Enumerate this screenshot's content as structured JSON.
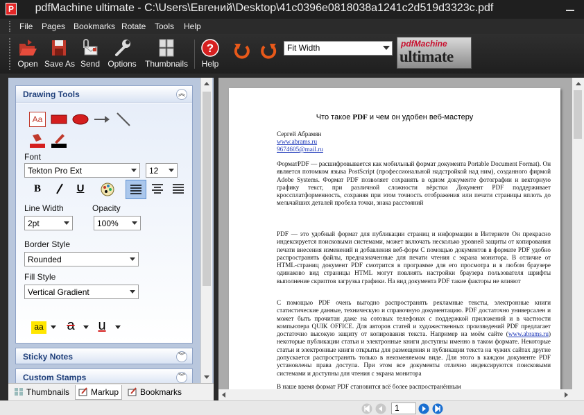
{
  "window": {
    "title": "pdfMachine ultimate - C:\\Users\\Евгений\\Desktop\\41c0396e0818038a1241c2d519d3323c.pdf",
    "app_icon_letter": "P"
  },
  "menu": {
    "items": [
      "File",
      "Pages",
      "Bookmarks",
      "Rotate",
      "Tools",
      "Help"
    ]
  },
  "toolbar": {
    "open": "Open",
    "save_as": "Save As",
    "send": "Send",
    "options": "Options",
    "thumbnails": "Thumbnails",
    "help": "Help",
    "zoom_value": "Fit Width",
    "logo_top": "pdfMachine",
    "logo_bottom": "ultimate"
  },
  "drawing_tools": {
    "title": "Drawing Tools",
    "tool_text_label": "Aa",
    "font_label": "Font",
    "font_value": "Tekton Pro Ext",
    "font_size": "12",
    "bold": "B",
    "italic": "I",
    "underline": "U",
    "line_width_label": "Line Width",
    "line_width_value": "2pt",
    "opacity_label": "Opacity",
    "opacity_value": "100%",
    "border_style_label": "Border Style",
    "border_style_value": "Rounded",
    "fill_style_label": "Fill Style",
    "fill_style_value": "Vertical Gradient",
    "highlight_sample": "aa",
    "strike_sample": "a",
    "underline_sample": "u"
  },
  "panels": {
    "sticky_notes": "Sticky Notes",
    "custom_stamps": "Custom Stamps"
  },
  "tabs": {
    "thumbnails": "Thumbnails",
    "markup": "Markup",
    "bookmarks": "Bookmarks"
  },
  "document": {
    "title_pre": "Что такое ",
    "title_bold": "PDF",
    "title_post": " и чем он удобен веб-мастеру",
    "author": "Сергей Абрамян",
    "site": "www.abrams.ru",
    "email": "9674605@mail.ru",
    "p1": "ФорматPDF — расшифровывается как мобильный формат документа Portable Document Format). Он является потомком языка PostScript (профессиональной надстройкой над ним), созданного фирмой Adobe Systems. Формат PDF позволяет сохранять в одном документе фотографии и векторную графику текст, при различной сложности вёрстки Документ PDF поддерживает кроссплатформенность, сохраняя при этом точность отображения или печати страницы вплоть до мельчайших деталей пробела точки, знака расстояний",
    "p2": "PDF — это удобный формат для публикации страниц и информации в Интернете Он прекрасно индексируется поисковыми системами, может включать несколько уровней защиты от копирования печати внесения изменений и добавления веб-форм С помощью документов в формате PDF удобно распространять файлы, предназначенные для печати чтения с экрана монитора. В отличие от HTML-страниц документ PDF смотрится в программе для его просмотра и в любом браузере одинаково вид страницы HTML могут повлиять настройки браузера пользователя шрифты выполнение скриптов загрузка графики. На вид документа PDF такие факторы не влияют",
    "p3_a": "С помощью PDF очень выгодно распространять рекламные тексты, электронные книги статистические данные, техническую и справочную документацию. PDF достаточно универсален и может быть прочитан даже на сотовых телефонах с поддержкой приложений и в частности компьютера QUIK OFFICE. Для авторов статей и художественных произведений PDF предлагает достаточно высокую защиту от копирования текста. Например на моём сайте (",
    "p3_link": "www.abrams.ru",
    "p3_b": ") некоторые публикации статьи и электронные книги доступны именно в таком формате. Некоторые статьи и электронные книги открыты для размещения и публикации текста на чужих сайтах другие допускается распространять только в неизменяемом виде. Для этого в каждом документе PDF установлены права доступа. При этом все документы отлично индексируются поисковыми системами и доступны для чтения с экрана монитора",
    "p4_partial": "В наше время формат PDF становится всё более распространённым"
  },
  "status": {
    "page": "1"
  }
}
